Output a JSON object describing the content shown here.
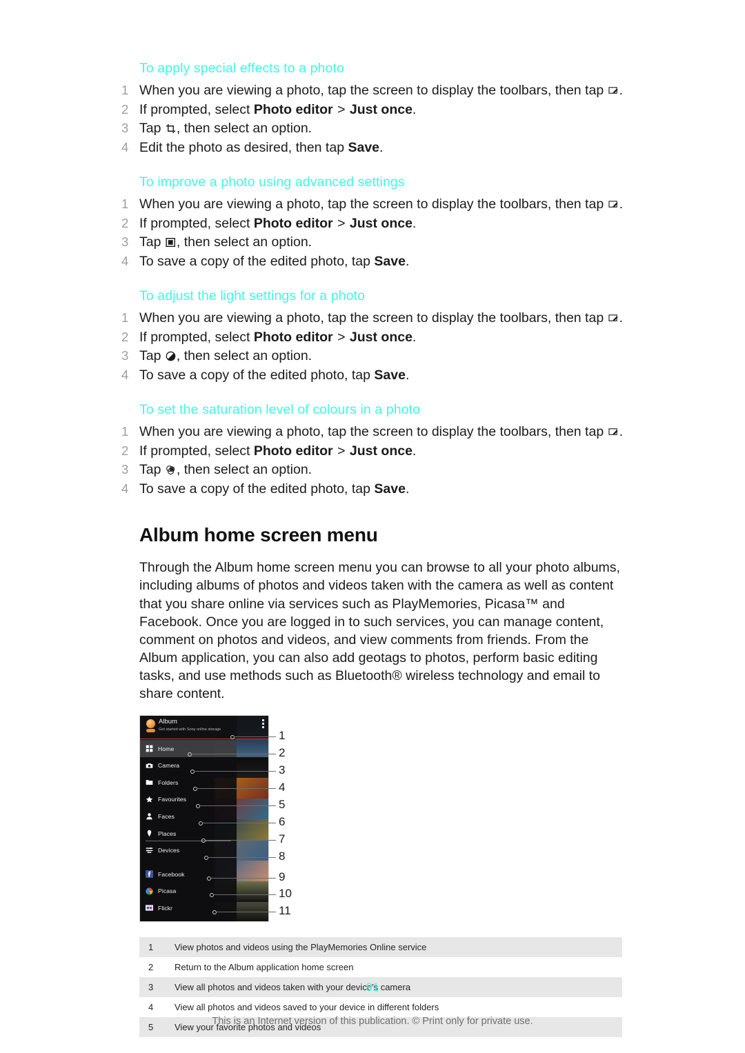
{
  "procedures": [
    {
      "heading": "To apply special effects to a photo",
      "steps": [
        {
          "num": "1",
          "pre": "When you are viewing a photo, tap the screen to display the toolbars, then tap ",
          "icon": "edit-frame-icon",
          "post": "."
        },
        {
          "num": "2",
          "pre": "If prompted, select ",
          "bold1": "Photo editor",
          "mid": " > ",
          "bold2": "Just once",
          "post": "."
        },
        {
          "num": "3",
          "pre": "Tap ",
          "icon": "crop-icon",
          "post": ", then select an option."
        },
        {
          "num": "4",
          "pre": "Edit the photo as desired, then tap ",
          "bold1": "Save",
          "post": "."
        }
      ]
    },
    {
      "heading": "To improve a photo using advanced settings",
      "steps": [
        {
          "num": "1",
          "pre": "When you are viewing a photo, tap the screen to display the toolbars, then tap ",
          "icon": "edit-frame-icon",
          "post": "."
        },
        {
          "num": "2",
          "pre": "If prompted, select ",
          "bold1": "Photo editor",
          "mid": " > ",
          "bold2": "Just once",
          "post": "."
        },
        {
          "num": "3",
          "pre": "Tap ",
          "icon": "frame-square-icon",
          "post": ", then select an option."
        },
        {
          "num": "4",
          "pre": "To save a copy of the edited photo, tap ",
          "bold1": "Save",
          "post": "."
        }
      ]
    },
    {
      "heading": "To adjust the light settings for a photo",
      "steps": [
        {
          "num": "1",
          "pre": "When you are viewing a photo, tap the screen to display the toolbars, then tap ",
          "icon": "edit-frame-icon",
          "post": "."
        },
        {
          "num": "2",
          "pre": "If prompted, select ",
          "bold1": "Photo editor",
          "mid": " > ",
          "bold2": "Just once",
          "post": "."
        },
        {
          "num": "3",
          "pre": "Tap ",
          "icon": "brightness-contrast-icon",
          "post": ", then select an option."
        },
        {
          "num": "4",
          "pre": "To save a copy of the edited photo, tap ",
          "bold1": "Save",
          "post": "."
        }
      ]
    },
    {
      "heading": "To set the saturation level of colours in a photo",
      "steps": [
        {
          "num": "1",
          "pre": "When you are viewing a photo, tap the screen to display the toolbars, then tap ",
          "icon": "edit-frame-icon",
          "post": "."
        },
        {
          "num": "2",
          "pre": "If prompted, select ",
          "bold1": "Photo editor",
          "mid": " > ",
          "bold2": "Just once",
          "post": "."
        },
        {
          "num": "3",
          "pre": "Tap ",
          "icon": "saturation-circles-icon",
          "post": ", then select an option."
        },
        {
          "num": "4",
          "pre": "To save a copy of the edited photo, tap ",
          "bold1": "Save",
          "post": "."
        }
      ]
    }
  ],
  "section": {
    "title": "Album home screen menu",
    "body": "Through the Album home screen menu you can browse to all your photo albums, including albums of photos and videos taken with the camera as well as content that you share online via services such as PlayMemories, Picasa™ and Facebook. Once you are logged in to such services, you can manage content, comment on photos and videos, and view comments from friends. From the Album application, you can also add geotags to photos, perform basic editing tasks, and use methods such as Bluetooth® wireless technology and email to share content."
  },
  "figure": {
    "app_title": "Album",
    "app_subtitle": "Get started with Sony online storage",
    "menu_items": [
      {
        "label": "Home",
        "icon": "home-grid-icon",
        "selected": true
      },
      {
        "label": "Camera",
        "icon": "camera-icon",
        "selected": false
      },
      {
        "label": "Folders",
        "icon": "folder-icon",
        "selected": false
      },
      {
        "label": "Favourites",
        "icon": "star-icon",
        "selected": false
      },
      {
        "label": "Faces",
        "icon": "person-icon",
        "selected": false
      },
      {
        "label": "Places",
        "icon": "pin-icon",
        "selected": false
      },
      {
        "label": "Devices",
        "icon": "devices-icon",
        "selected": false
      },
      {
        "label": "Facebook",
        "icon": "facebook-icon",
        "selected": false
      },
      {
        "label": "Picasa",
        "icon": "picasa-icon",
        "selected": false
      },
      {
        "label": "Flickr",
        "icon": "flickr-icon",
        "selected": false
      }
    ],
    "callouts": [
      "1",
      "2",
      "3",
      "4",
      "5",
      "6",
      "7",
      "8",
      "9",
      "10",
      "11"
    ]
  },
  "legend": {
    "rows": [
      {
        "n": "1",
        "text": "View photos and videos using the PlayMemories Online service"
      },
      {
        "n": "2",
        "text": "Return to the Album application home screen"
      },
      {
        "n": "3",
        "text": "View all photos and videos taken with your device’s camera"
      },
      {
        "n": "4",
        "text": "View all photos and videos saved to your device in different folders"
      },
      {
        "n": "5",
        "text": "View your favorite photos and videos"
      }
    ]
  },
  "footer": {
    "page_number": "91",
    "note": "This is an Internet version of this publication. © Print only for private use."
  },
  "colors": {
    "heading": "#3dfbe0",
    "text": "#1b1b1b",
    "step_number": "#9d9d9d",
    "table_shade": "#e7e7e7",
    "footer_note": "#6f6f6f"
  }
}
